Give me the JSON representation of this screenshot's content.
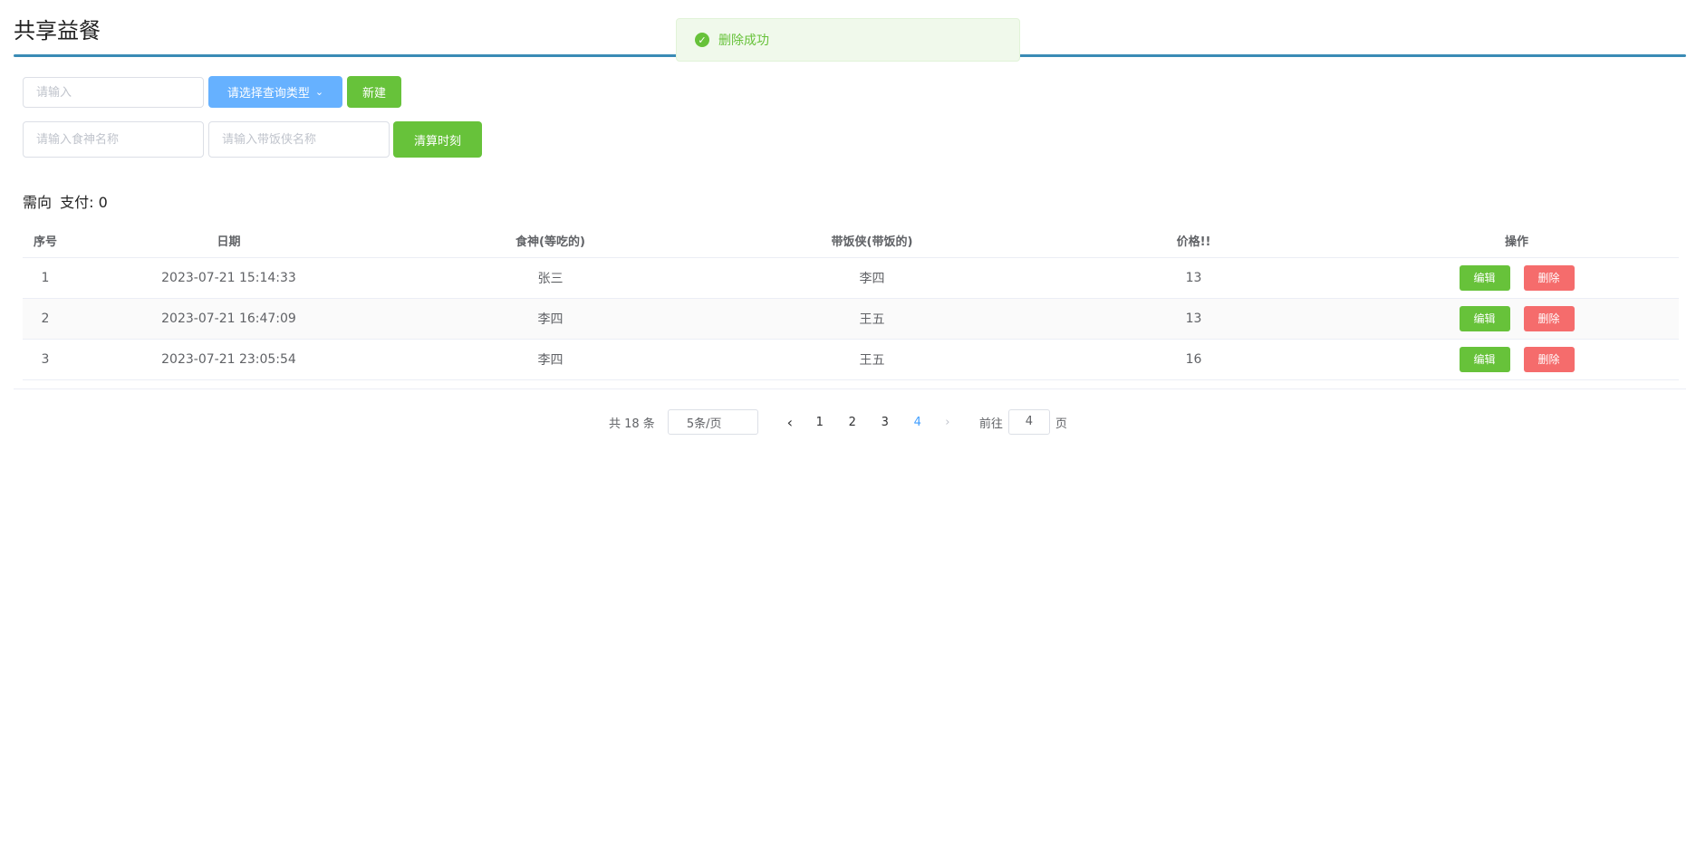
{
  "header": {
    "title": "共享益餐"
  },
  "toast": {
    "message": "删除成功",
    "icon": "check-circle-icon"
  },
  "toolbar": {
    "search_placeholder": "请输入",
    "query_type_label": "请选择查询类型",
    "new_label": "新建",
    "eater_placeholder": "请输入食神名称",
    "carrier_placeholder": "请输入带饭侠名称",
    "settle_label": "清算时刻"
  },
  "summary": {
    "label": "需向",
    "pay_text": "支付: 0"
  },
  "table": {
    "headers": [
      "序号",
      "日期",
      "食神(等吃的)",
      "带饭侠(带饭的)",
      "价格!!",
      "操作"
    ],
    "rows": [
      {
        "index": "1",
        "date": "2023-07-21 15:14:33",
        "eater": "张三",
        "carrier": "李四",
        "price": "13"
      },
      {
        "index": "2",
        "date": "2023-07-21 16:47:09",
        "eater": "李四",
        "carrier": "王五",
        "price": "13"
      },
      {
        "index": "3",
        "date": "2023-07-21 23:05:54",
        "eater": "李四",
        "carrier": "王五",
        "price": "16"
      }
    ],
    "edit_label": "编辑",
    "delete_label": "删除"
  },
  "pagination": {
    "total_text": "共 18 条",
    "page_size": "5条/页",
    "pages": [
      "1",
      "2",
      "3",
      "4"
    ],
    "current_page": "4",
    "goto_prefix": "前往",
    "goto_value": "4",
    "goto_suffix": "页"
  },
  "colors": {
    "accent_rule": "#3a8bb5",
    "primary_blue": "#66b1ff",
    "success_green": "#67c23a",
    "danger_red": "#f56c6c"
  }
}
